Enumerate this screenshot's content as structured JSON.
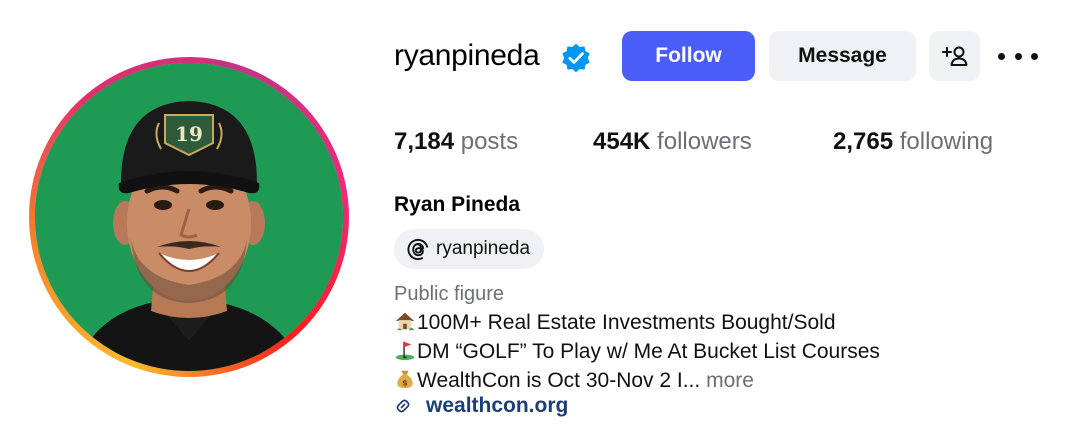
{
  "profile": {
    "username": "ryanpineda",
    "verified": true,
    "full_name": "Ryan Pineda",
    "threads_handle": "ryanpineda",
    "category": "Public figure",
    "cap_emblem_text": "19"
  },
  "actions": {
    "follow_label": "Follow",
    "message_label": "Message"
  },
  "stats": {
    "posts_count": "7,184",
    "posts_label": "posts",
    "followers_count": "454K",
    "followers_label": "followers",
    "following_count": "2,765",
    "following_label": "following"
  },
  "bio": {
    "line1": "100M+ Real Estate Investments Bought/Sold",
    "line1_icon": "house-emoji",
    "line2": "DM “GOLF” To Play w/ Me At Bucket List Courses",
    "line2_icon": "golf-flag-emoji",
    "line3": "WealthCon is Oct 30-Nov 2 I...",
    "line3_icon": "money-bag-emoji",
    "more_label": "more"
  },
  "link": {
    "text": "wealthcon.org",
    "icon": "link-icon"
  },
  "colors": {
    "follow_button": "#4a5df9",
    "secondary_button": "#eff1f4",
    "verified_badge": "#0095f6",
    "link_text": "#1b3f74",
    "muted_text": "#6b6f76",
    "avatar_background": "#1f9a55"
  }
}
